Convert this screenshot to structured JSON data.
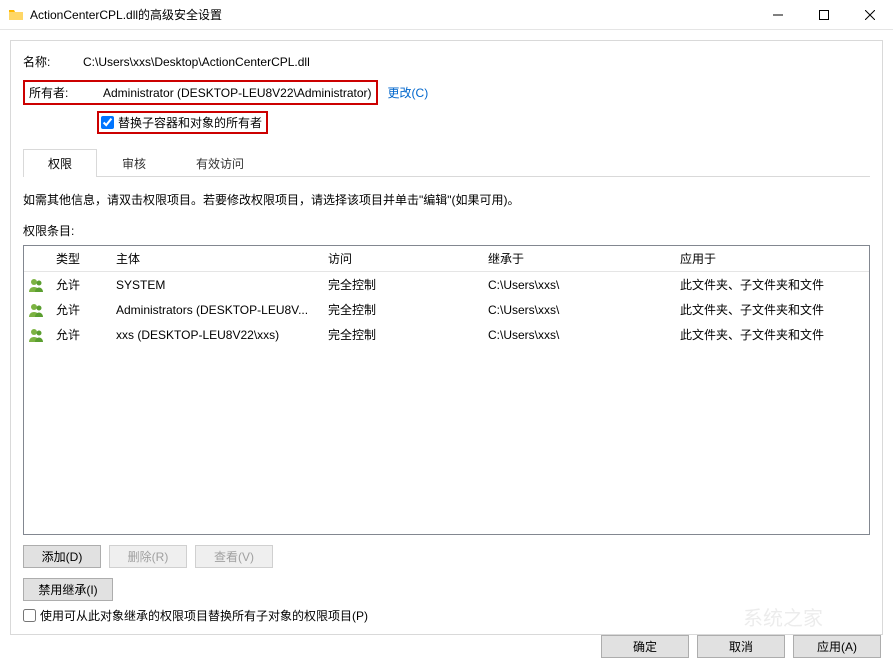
{
  "titlebar": {
    "title": "ActionCenterCPL.dll的高级安全设置"
  },
  "name_label": "名称:",
  "name_value": "C:\\Users\\xxs\\Desktop\\ActionCenterCPL.dll",
  "owner_label": "所有者:",
  "owner_value": "Administrator (DESKTOP-LEU8V22\\Administrator)",
  "change_link": "更改(C)",
  "replace_owner_checkbox": "替换子容器和对象的所有者",
  "tabs": {
    "t0": "权限",
    "t1": "审核",
    "t2": "有效访问"
  },
  "info_text": "如需其他信息，请双击权限项目。若要修改权限项目，请选择该项目并单击\"编辑\"(如果可用)。",
  "perm_entries_label": "权限条目:",
  "columns": {
    "type": "类型",
    "principal": "主体",
    "access": "访问",
    "inherit": "继承于",
    "apply": "应用于"
  },
  "rows": [
    {
      "type": "允许",
      "principal": "SYSTEM",
      "access": "完全控制",
      "inherit": "C:\\Users\\xxs\\",
      "apply": "此文件夹、子文件夹和文件"
    },
    {
      "type": "允许",
      "principal": "Administrators (DESKTOP-LEU8V...",
      "access": "完全控制",
      "inherit": "C:\\Users\\xxs\\",
      "apply": "此文件夹、子文件夹和文件"
    },
    {
      "type": "允许",
      "principal": "xxs (DESKTOP-LEU8V22\\xxs)",
      "access": "完全控制",
      "inherit": "C:\\Users\\xxs\\",
      "apply": "此文件夹、子文件夹和文件"
    }
  ],
  "buttons": {
    "add": "添加(D)",
    "remove": "删除(R)",
    "view": "查看(V)",
    "disable_inherit": "禁用继承(I)",
    "replace_children": "使用可从此对象继承的权限项目替换所有子对象的权限项目(P)",
    "ok": "确定",
    "cancel": "取消",
    "apply": "应用(A)"
  }
}
